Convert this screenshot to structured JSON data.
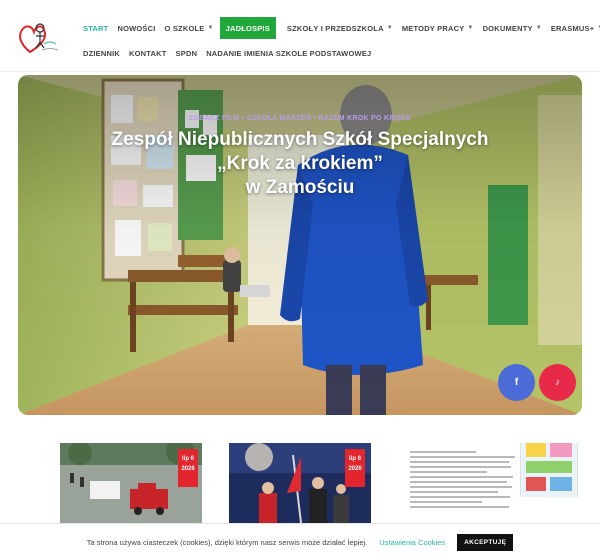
{
  "nav": {
    "row1": [
      {
        "label": "START",
        "style": "active"
      },
      {
        "label": "NOWOŚCI",
        "style": "normal"
      },
      {
        "label": "O SZKOLE",
        "style": "normal",
        "dropdown": true
      },
      {
        "label": "JADŁOSPIS",
        "style": "highlight"
      },
      {
        "label": "SZKOŁY I PRZEDSZKOLA",
        "style": "normal",
        "dropdown": true
      },
      {
        "label": "METODY PRACY",
        "style": "normal",
        "dropdown": true
      },
      {
        "label": "DOKUMENTY",
        "style": "normal",
        "dropdown": true
      },
      {
        "label": "ERASMUS+",
        "style": "normal",
        "dropdown": true
      }
    ],
    "row2": [
      {
        "label": "DZIENNIK"
      },
      {
        "label": "KONTAKT"
      },
      {
        "label": "SPDN"
      },
      {
        "label": "NADANIE IMIENIA SZKOLE PODSTAWOWEJ"
      }
    ]
  },
  "hero": {
    "kicker": "ZOBACZ FILM • SZKOŁA MARZEŃ • RAZEM KROK PO KROKU",
    "title_line1": "Zespół Niepublicznych Szkół Specjalnych",
    "title_line2": "„Krok za krokiem”",
    "title_line3": "w Zamościu"
  },
  "social": {
    "facebook": "f",
    "tiktok": "♪"
  },
  "cards": [
    {
      "date_line1": "lip 6",
      "date_line2": "2026"
    },
    {
      "date_line1": "lip 6",
      "date_line2": "2026"
    }
  ],
  "cookie": {
    "text": "Ta strona używa ciasteczek (cookies), dzięki którym nasz serwis może działać lepiej.",
    "settings": "Ustawienia Cookies",
    "accept": "AKCEPTUJĘ"
  },
  "colors": {
    "accent": "#2cb5a4",
    "highlight": "#22a83a",
    "facebook": "#4c6ad8",
    "tiktok": "#e8294a",
    "badge": "#e3262e"
  }
}
